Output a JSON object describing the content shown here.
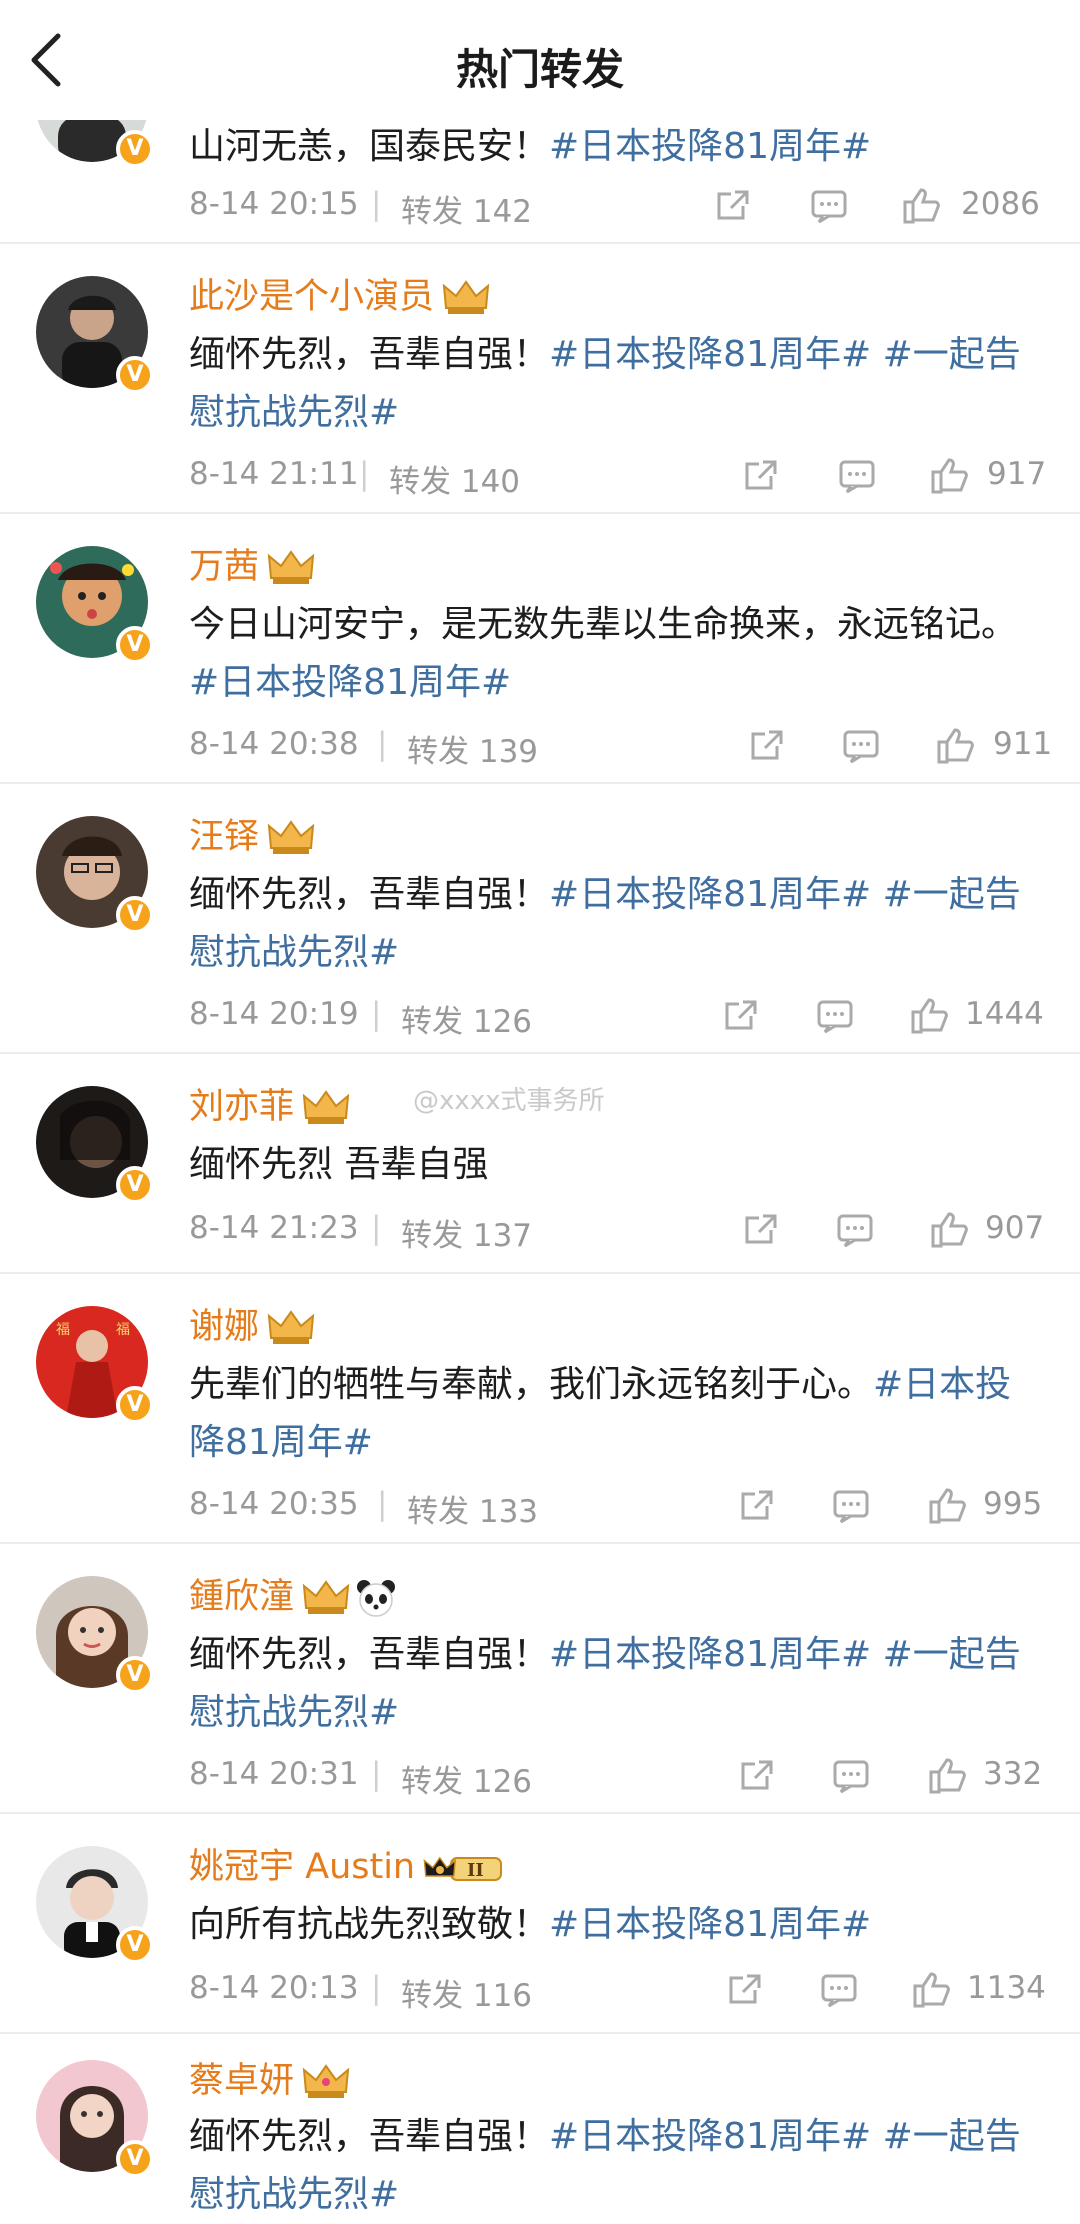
{
  "header": {
    "title": "热门转发"
  },
  "watermark": "@xxxx式事务所",
  "posts": [
    {
      "name": "",
      "content": "山河无恙，国泰民安！",
      "tags": "#日本投降81周年#",
      "time": "8-14 20:15",
      "repost": "转发 142",
      "likes": "2086"
    },
    {
      "name": "此沙是个小演员",
      "content": "缅怀先烈，吾辈自强！",
      "tags": "#日本投降81周年# #一起告慰抗战先烈#",
      "time": "8-14 21:11",
      "repost": "转发 140",
      "likes": "917"
    },
    {
      "name": "万茜",
      "content": "今日山河安宁，是无数先辈以生命换来，永远铭记。",
      "tags": "#日本投降81周年#",
      "time": "8-14 20:38",
      "repost": "转发 139",
      "likes": "911"
    },
    {
      "name": "汪铎",
      "content": "缅怀先烈，吾辈自强！",
      "tags": "#日本投降81周年# #一起告慰抗战先烈#",
      "time": "8-14 20:19",
      "repost": "转发 126",
      "likes": "1444"
    },
    {
      "name": "刘亦菲",
      "content": "缅怀先烈 吾辈自强",
      "tags": "",
      "time": "8-14 21:23",
      "repost": "转发 137",
      "likes": "907"
    },
    {
      "name": "谢娜",
      "content": "先辈们的牺牲与奉献，我们永远铭刻于心。",
      "tags": "#日本投降81周年#",
      "time": "8-14 20:35",
      "repost": "转发 133",
      "likes": "995"
    },
    {
      "name": "鍾欣潼",
      "content": "缅怀先烈，吾辈自强！",
      "tags": "#日本投降81周年# #一起告慰抗战先烈#",
      "time": "8-14 20:31",
      "repost": "转发 126",
      "likes": "332"
    },
    {
      "name": "姚冠宇 Austin",
      "content": "向所有抗战先烈致敬！",
      "tags": "#日本投降81周年#",
      "time": "8-14 20:13",
      "repost": "转发 116",
      "likes": "1134"
    },
    {
      "name": "蔡卓妍",
      "content": "缅怀先烈，吾辈自强！",
      "tags": "#日本投降81周年# #一起告慰抗战先烈#",
      "time": "",
      "repost": "",
      "likes": ""
    }
  ],
  "icons": {
    "back": "chevron-left-icon",
    "share": "share-icon",
    "comment": "comment-icon",
    "like": "thumbs-up-icon",
    "verified": "verified-badge-icon",
    "crown": "crown-icon"
  },
  "colors": {
    "name": "#e57c1c",
    "hashtag": "#3f6e9f",
    "meta": "#999999",
    "verified": "#f7a21b"
  }
}
